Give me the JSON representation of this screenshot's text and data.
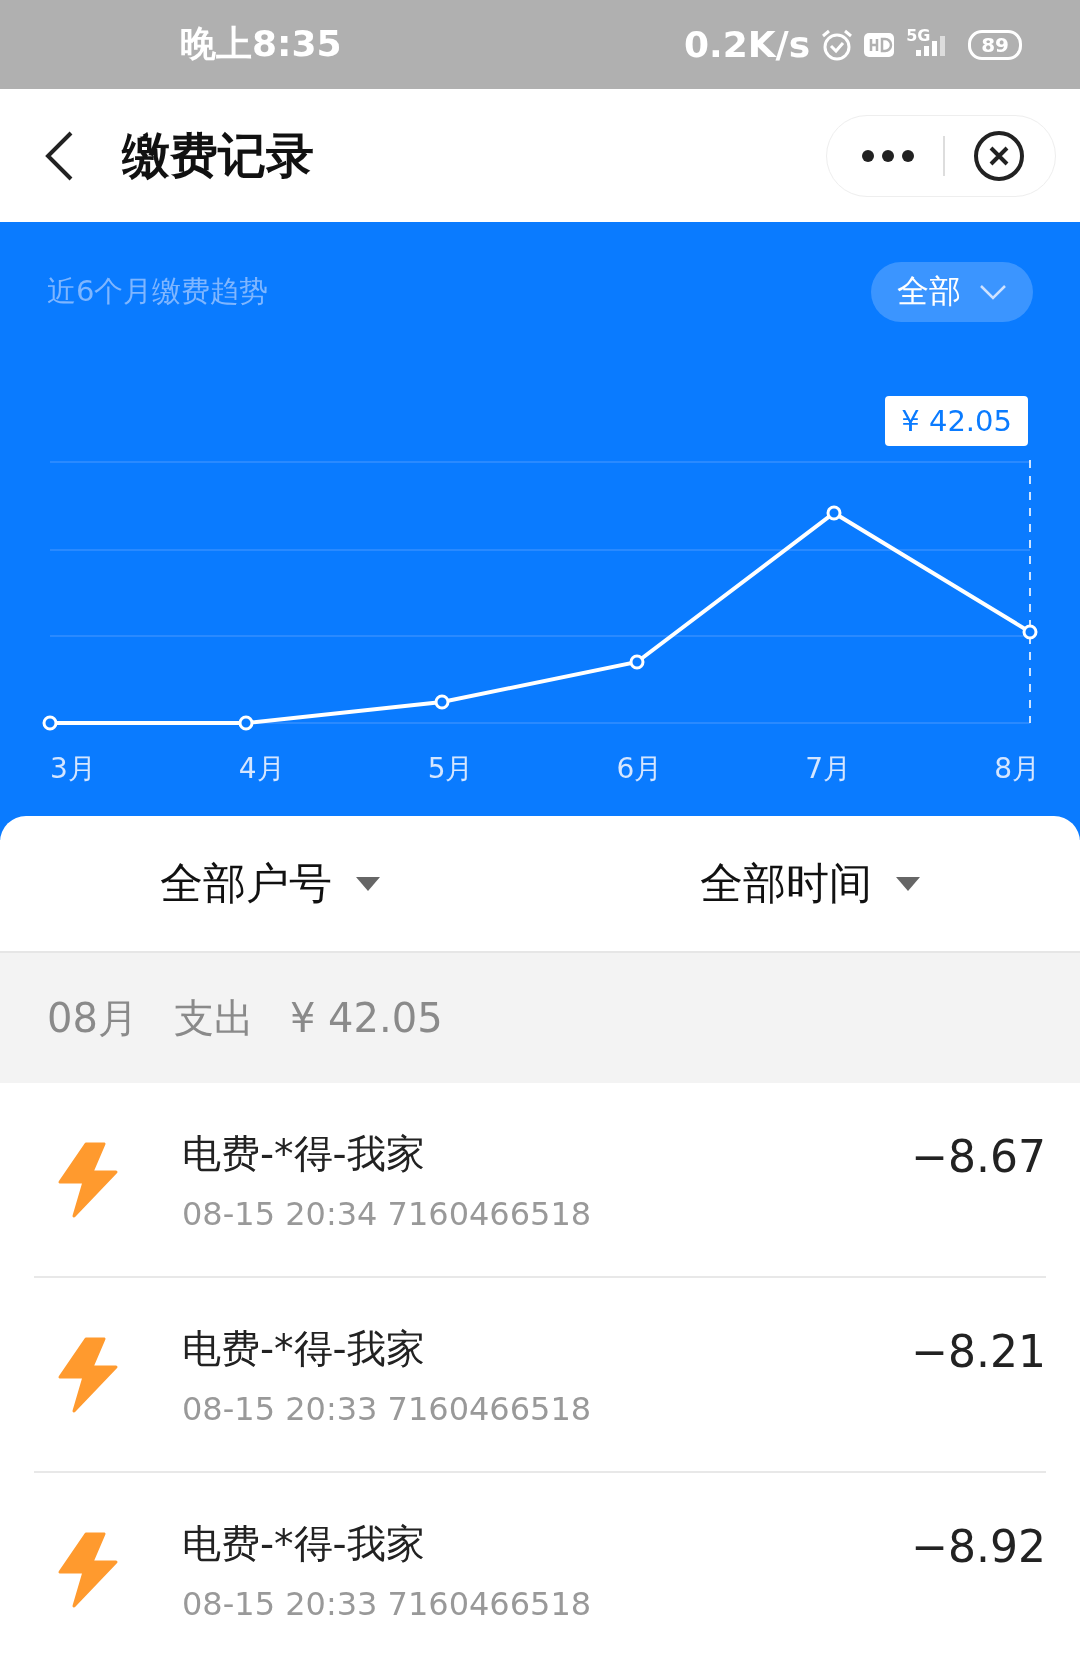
{
  "status_bar": {
    "time": "晚上8:35",
    "speed": "0.2K/s",
    "network": "5G",
    "battery": "89"
  },
  "header": {
    "title": "缴费记录"
  },
  "trend": {
    "title": "近6个月缴费趋势",
    "filter": "全部",
    "tooltip": "¥ 42.05",
    "months": [
      "3月",
      "4月",
      "5月",
      "6月",
      "7月",
      "8月"
    ]
  },
  "filters": [
    "全部户号",
    "全部时间"
  ],
  "month_summary": {
    "month": "08月",
    "label": "支出",
    "total": "¥ 42.05"
  },
  "records": [
    {
      "name": "电费-*得-我家",
      "detail": "08-15 20:34 7160466518",
      "amount": "−8.67"
    },
    {
      "name": "电费-*得-我家",
      "detail": "08-15 20:33 7160466518",
      "amount": "−8.21"
    },
    {
      "name": "电费-*得-我家",
      "detail": "08-15 20:33 7160466518",
      "amount": "−8.92"
    }
  ]
}
